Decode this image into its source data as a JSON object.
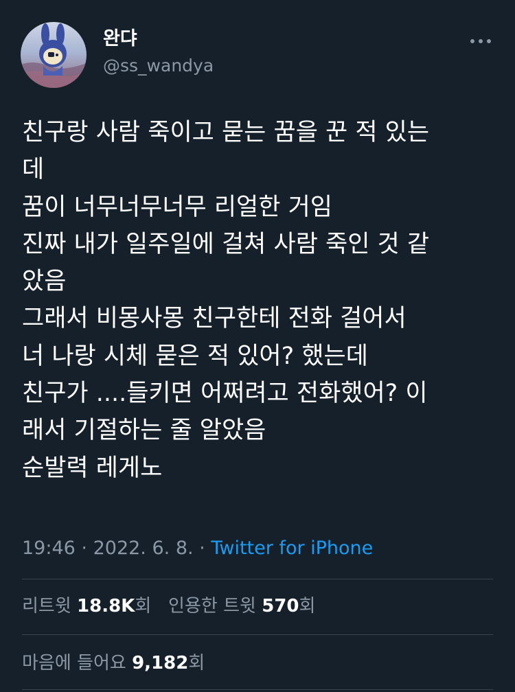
{
  "author": {
    "display_name": "완댜",
    "handle": "@ss_wandya",
    "avatar_icon": "rabbit-character-avatar-icon"
  },
  "more_icon": "more-options-icon",
  "tweet": {
    "text": "친구랑 사람 죽이고 묻는 꿈을 꾼 적 있는\n데\n꿈이 너무너무너무 리얼한 거임\n진짜 내가 일주일에 걸쳐 사람 죽인 것 같\n았음\n그래서 비몽사몽 친구한테 전화 걸어서\n너 나랑 시체 묻은 적 있어? 했는데\n친구가 ....들키면 어쩌려고 전화했어? 이\n래서 기절하는 줄 알았음\n순발력 레게노",
    "time": "19:46",
    "date": "2022. 6. 8.",
    "separator": "·",
    "source": "Twitter for iPhone"
  },
  "stats": {
    "retweets_label": "리트윗",
    "retweets_count": "18.8K",
    "retweets_unit": "회",
    "quotes_label": "인용한 트윗",
    "quotes_count": "570",
    "quotes_unit": "회",
    "likes_label": "마음에 들어요",
    "likes_count": "9,182",
    "likes_unit": "회"
  },
  "colors": {
    "background": "#15202b",
    "text_primary": "#ffffff",
    "text_secondary": "#8b98a5",
    "link": "#1d9bf0",
    "divider": "#38444d"
  }
}
